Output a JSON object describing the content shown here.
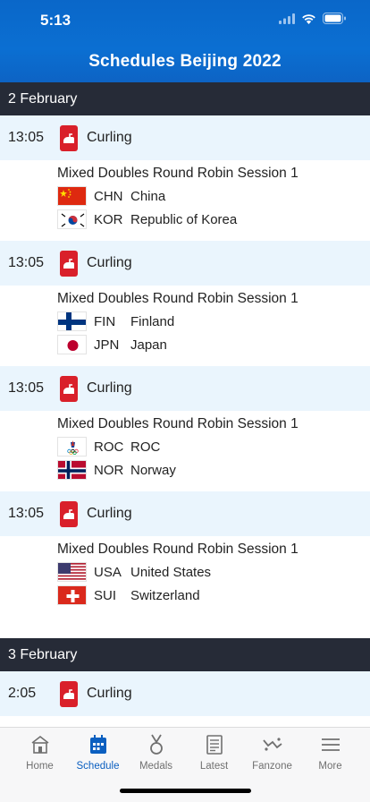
{
  "status_bar": {
    "time": "5:13"
  },
  "header": {
    "title": "Schedules Beijing 2022"
  },
  "days": [
    {
      "date": "2 February",
      "events": [
        {
          "time": "13:05",
          "sport": "Curling",
          "title": "Mixed Doubles Round Robin Session 1",
          "teams": [
            {
              "code": "CHN",
              "name": "China",
              "flag": "chn"
            },
            {
              "code": "KOR",
              "name": "Republic of Korea",
              "flag": "kor"
            }
          ]
        },
        {
          "time": "13:05",
          "sport": "Curling",
          "title": "Mixed Doubles Round Robin Session 1",
          "teams": [
            {
              "code": "FIN",
              "name": "Finland",
              "flag": "fin"
            },
            {
              "code": "JPN",
              "name": "Japan",
              "flag": "jpn"
            }
          ]
        },
        {
          "time": "13:05",
          "sport": "Curling",
          "title": "Mixed Doubles Round Robin Session 1",
          "teams": [
            {
              "code": "ROC",
              "name": "ROC",
              "flag": "roc"
            },
            {
              "code": "NOR",
              "name": "Norway",
              "flag": "nor"
            }
          ]
        },
        {
          "time": "13:05",
          "sport": "Curling",
          "title": "Mixed Doubles Round Robin Session 1",
          "teams": [
            {
              "code": "USA",
              "name": "United States",
              "flag": "usa"
            },
            {
              "code": "SUI",
              "name": "Switzerland",
              "flag": "sui"
            }
          ]
        }
      ]
    },
    {
      "date": "3 February",
      "events": [
        {
          "time": "2:05",
          "sport": "Curling"
        }
      ]
    }
  ],
  "tabs": [
    {
      "label": "Home",
      "icon": "home-icon",
      "active": false
    },
    {
      "label": "Schedule",
      "icon": "calendar-icon",
      "active": true
    },
    {
      "label": "Medals",
      "icon": "medal-icon",
      "active": false
    },
    {
      "label": "Latest",
      "icon": "document-icon",
      "active": false
    },
    {
      "label": "Fanzone",
      "icon": "fanzone-icon",
      "active": false
    },
    {
      "label": "More",
      "icon": "menu-icon",
      "active": false
    }
  ],
  "colors": {
    "header_blue": "#0b6fd2",
    "date_bar": "#262b37",
    "event_bg": "#eaf5fd",
    "sport_red": "#d9202a",
    "active_tab": "#0b5fc0"
  }
}
